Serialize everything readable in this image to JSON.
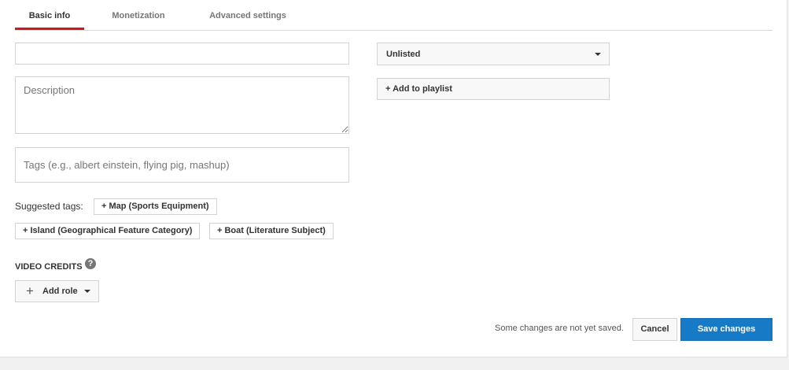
{
  "tabs": [
    {
      "label": "Basic info",
      "active": true
    },
    {
      "label": "Monetization",
      "active": false
    },
    {
      "label": "Advanced settings",
      "active": false
    }
  ],
  "form": {
    "title_value": "",
    "description_placeholder": "Description",
    "tags_placeholder": "Tags (e.g., albert einstein, flying pig, mashup)"
  },
  "privacy": {
    "selected": "Unlisted"
  },
  "playlist": {
    "button_label": "+ Add to playlist"
  },
  "suggested_tags": {
    "label": "Suggested tags:",
    "tags": [
      "+ Map (Sports Equipment)",
      "+ Island (Geographical Feature Category)",
      "+ Boat (Literature Subject)"
    ]
  },
  "video_credits": {
    "heading": "VIDEO CREDITS",
    "add_role_label": "Add role"
  },
  "footer": {
    "status": "Some changes are not yet saved.",
    "cancel_label": "Cancel",
    "save_label": "Save changes"
  },
  "colors": {
    "accent_red": "#cc181e",
    "save_blue": "#167ac6"
  }
}
